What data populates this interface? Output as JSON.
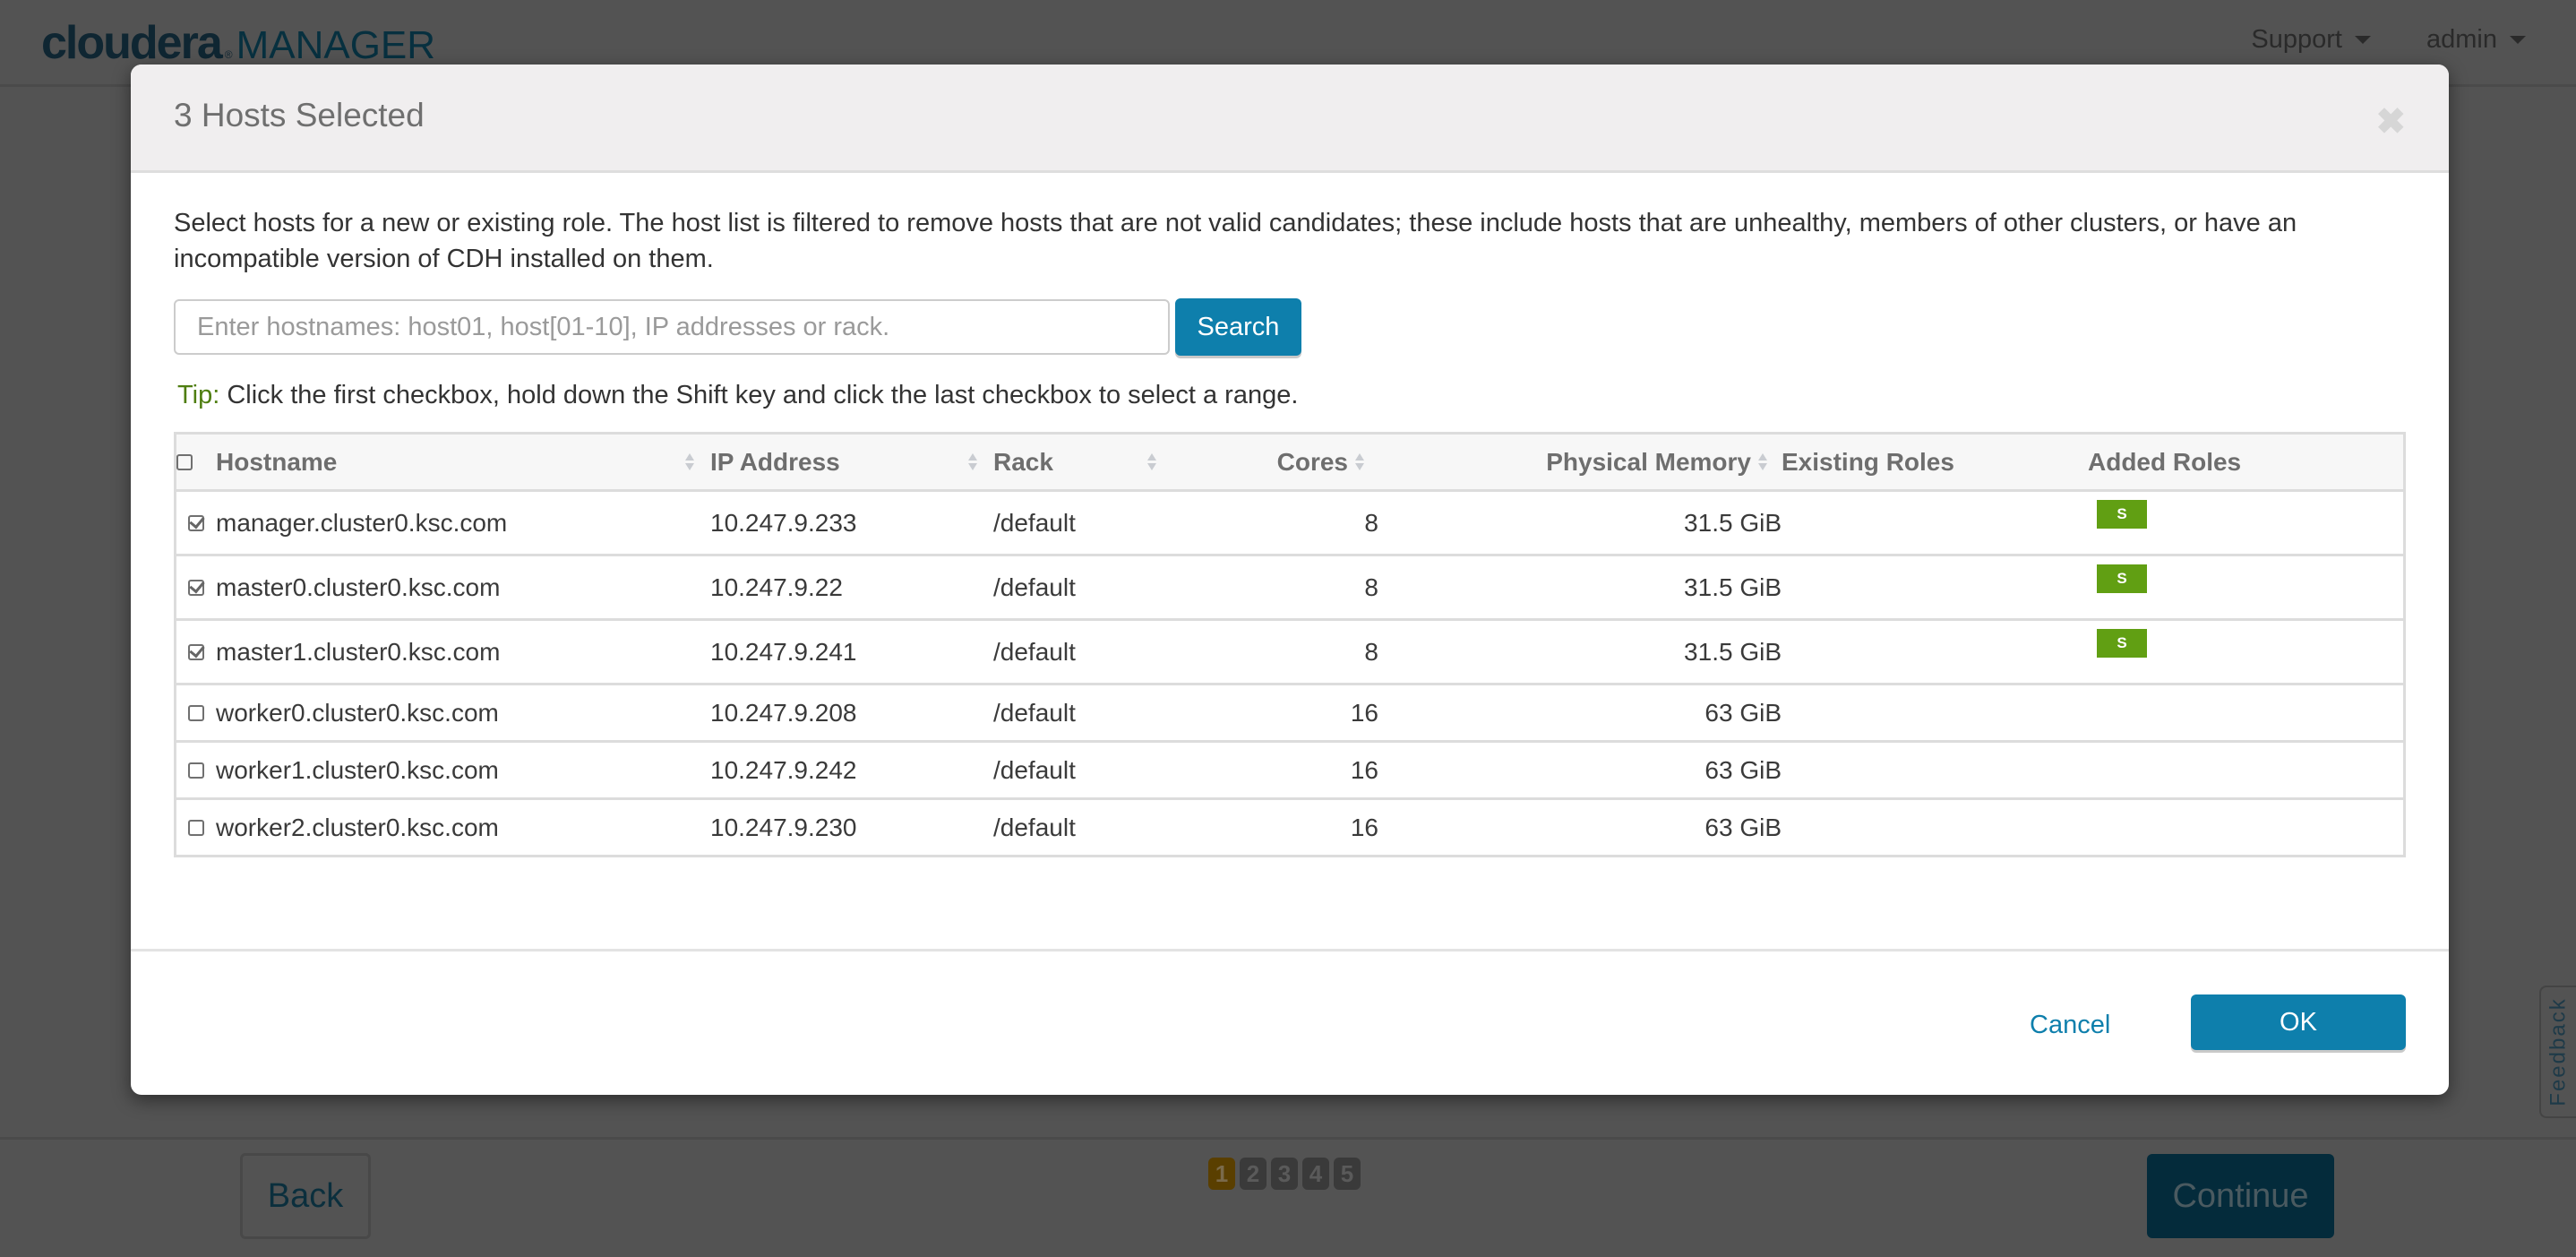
{
  "app": {
    "logo_primary": "cloudera",
    "logo_reg": "®",
    "logo_secondary": "MANAGER"
  },
  "nav": {
    "support": "Support",
    "user": "admin"
  },
  "wizard": {
    "back_label": "Back",
    "continue_label": "Continue",
    "steps": [
      "1",
      "2",
      "3",
      "4",
      "5"
    ],
    "active_step": 1,
    "feedback_label": "Feedback"
  },
  "modal": {
    "title": "3 Hosts Selected",
    "close_glyph": "✖",
    "intro": "Select hosts for a new or existing role. The host list is filtered to remove hosts that are not valid candidates; these include hosts that are unhealthy, members of other clusters, or have an incompatible version of CDH installed on them.",
    "search": {
      "placeholder": "Enter hostnames: host01, host[01-10], IP addresses or rack.",
      "value": "",
      "button": "Search"
    },
    "tip_label": "Tip:",
    "tip_text": " Click the first checkbox, hold down the Shift key and click the last checkbox to select a range.",
    "table": {
      "headers": {
        "hostname": "Hostname",
        "ip": "IP Address",
        "rack": "Rack",
        "cores": "Cores",
        "memory": "Physical Memory",
        "existing_roles": "Existing Roles",
        "added_roles": "Added Roles"
      },
      "select_all_checked": false,
      "rows": [
        {
          "checked": true,
          "hostname": "manager.cluster0.ksc.com",
          "ip": "10.247.9.233",
          "rack": "/default",
          "cores": "8",
          "memory": "31.5 GiB",
          "existing_roles": "",
          "added_roles": "S"
        },
        {
          "checked": true,
          "hostname": "master0.cluster0.ksc.com",
          "ip": "10.247.9.22",
          "rack": "/default",
          "cores": "8",
          "memory": "31.5 GiB",
          "existing_roles": "",
          "added_roles": "S"
        },
        {
          "checked": true,
          "hostname": "master1.cluster0.ksc.com",
          "ip": "10.247.9.241",
          "rack": "/default",
          "cores": "8",
          "memory": "31.5 GiB",
          "existing_roles": "",
          "added_roles": "S"
        },
        {
          "checked": false,
          "hostname": "worker0.cluster0.ksc.com",
          "ip": "10.247.9.208",
          "rack": "/default",
          "cores": "16",
          "memory": "63 GiB",
          "existing_roles": "",
          "added_roles": ""
        },
        {
          "checked": false,
          "hostname": "worker1.cluster0.ksc.com",
          "ip": "10.247.9.242",
          "rack": "/default",
          "cores": "16",
          "memory": "63 GiB",
          "existing_roles": "",
          "added_roles": ""
        },
        {
          "checked": false,
          "hostname": "worker2.cluster0.ksc.com",
          "ip": "10.247.9.230",
          "rack": "/default",
          "cores": "16",
          "memory": "63 GiB",
          "existing_roles": "",
          "added_roles": ""
        }
      ]
    },
    "cancel_label": "Cancel",
    "ok_label": "OK"
  },
  "colors": {
    "primary": "#0e7fac",
    "role_badge": "#619f13",
    "tip": "#4f7e11",
    "active_step": "#5a3f00"
  }
}
